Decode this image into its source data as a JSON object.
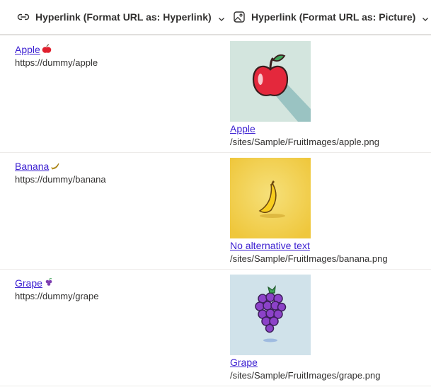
{
  "columns": [
    {
      "label": "Hyperlink (Format URL as: Hyperlink)",
      "icon": "link-icon"
    },
    {
      "label": "Hyperlink (Format URL as: Picture)",
      "icon": "picture-icon"
    }
  ],
  "rows": [
    {
      "link_text": "Apple",
      "emoji": "🍎",
      "url": "https://dummy/apple",
      "picture_alt_text": "Apple",
      "picture_path": "/sites/Sample/FruitImages/apple.png",
      "picture_icon": "apple-image"
    },
    {
      "link_text": "Banana",
      "emoji": "🍌",
      "url": "https://dummy/banana",
      "picture_alt_text": "No alternative text",
      "picture_path": "/sites/Sample/FruitImages/banana.png",
      "picture_icon": "banana-image"
    },
    {
      "link_text": "Grape",
      "emoji": "🍇",
      "url": "https://dummy/grape",
      "picture_alt_text": "Grape",
      "picture_path": "/sites/Sample/FruitImages/grape.png",
      "picture_icon": "grape-image"
    }
  ],
  "colors": {
    "link": "#3b1fd1",
    "text": "#323130",
    "divider": "#edebe9"
  }
}
